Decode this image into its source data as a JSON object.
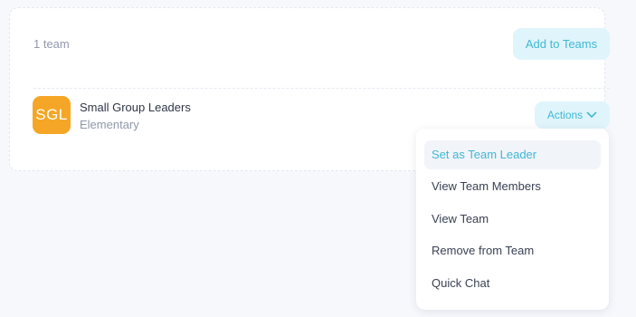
{
  "teams_panel": {
    "count_label": "1 team",
    "add_button_label": "Add to Teams"
  },
  "team": {
    "avatar_initials": "SGL",
    "name": "Small Group Leaders",
    "subtitle": "Elementary",
    "actions_label": "Actions"
  },
  "actions_menu": {
    "items": [
      {
        "label": "Set as Team Leader"
      },
      {
        "label": "View Team Members"
      },
      {
        "label": "View Team"
      },
      {
        "label": "Remove from Team"
      },
      {
        "label": "Quick Chat"
      }
    ]
  },
  "icons": {
    "actions_dropdown": "chevron-down-icon"
  },
  "colors": {
    "accent": "#41b8d6",
    "accent_bg": "#dff5fb",
    "avatar_bg": "#f5a626",
    "page_bg": "#f6f8fc"
  }
}
